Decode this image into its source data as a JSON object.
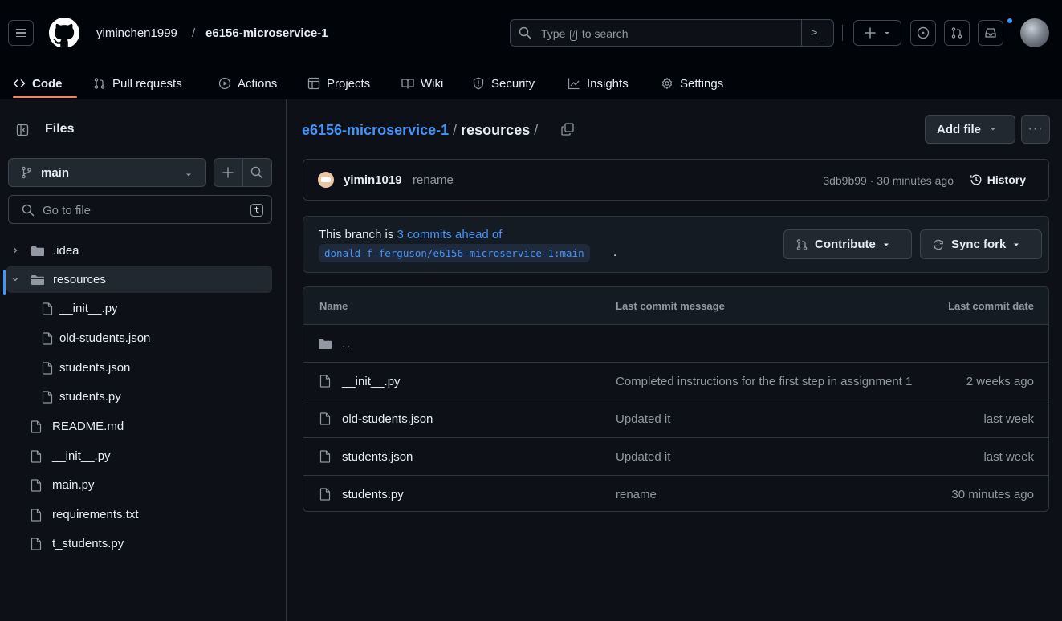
{
  "header": {
    "owner": "yiminchen1999",
    "separator": "/",
    "repo": "e6156-microservice-1",
    "search": {
      "prefix": "Type",
      "key": "/",
      "suffix": "to search",
      "command_palette": ">_"
    }
  },
  "nav": {
    "tabs": [
      {
        "label": "Code",
        "icon": "code-icon",
        "active": true
      },
      {
        "label": "Pull requests",
        "icon": "git-pull-request-icon"
      },
      {
        "label": "Actions",
        "icon": "play-icon"
      },
      {
        "label": "Projects",
        "icon": "table-icon"
      },
      {
        "label": "Wiki",
        "icon": "book-icon"
      },
      {
        "label": "Security",
        "icon": "shield-icon"
      },
      {
        "label": "Insights",
        "icon": "graph-icon"
      },
      {
        "label": "Settings",
        "icon": "gear-icon"
      }
    ]
  },
  "sidebar": {
    "title": "Files",
    "branch": "main",
    "goto_placeholder": "Go to file",
    "goto_shortcut": "t",
    "tree": [
      {
        "label": ".idea",
        "type": "folder",
        "depth": 0,
        "expanded": false
      },
      {
        "label": "resources",
        "type": "folder",
        "depth": 0,
        "expanded": true,
        "selected": true
      },
      {
        "label": "__init__.py",
        "type": "file",
        "depth": 1
      },
      {
        "label": "old-students.json",
        "type": "file",
        "depth": 1
      },
      {
        "label": "students.json",
        "type": "file",
        "depth": 1
      },
      {
        "label": "students.py",
        "type": "file",
        "depth": 1
      },
      {
        "label": "README.md",
        "type": "file",
        "depth": 0
      },
      {
        "label": "__init__.py",
        "type": "file",
        "depth": 0
      },
      {
        "label": "main.py",
        "type": "file",
        "depth": 0
      },
      {
        "label": "requirements.txt",
        "type": "file",
        "depth": 0
      },
      {
        "label": "t_students.py",
        "type": "file",
        "depth": 0
      }
    ]
  },
  "main": {
    "breadcrumb": {
      "repo": "e6156-microservice-1",
      "sep1": " / ",
      "current": "resources",
      "sep2": " /"
    },
    "add_file_label": "Add file",
    "more_label": "···",
    "latest_commit": {
      "author": "yimin1019",
      "message": "rename",
      "meta": "3db9b99 · 30 minutes ago",
      "history_label": "History"
    },
    "branch_status": {
      "prefix": "This branch is ",
      "link": "3 commits ahead of",
      "upstream": "donald-f-ferguson/e6156-microservice-1:main",
      "suffix": ".",
      "contribute_label": "Contribute",
      "sync_label": "Sync fork"
    },
    "table": {
      "headers": {
        "name": "Name",
        "message": "Last commit message",
        "date": "Last commit date"
      },
      "parent_label": "..",
      "rows": [
        {
          "name": "__init__.py",
          "message": "Completed instructions for the first step in assignment 1",
          "date": "2 weeks ago"
        },
        {
          "name": "old-students.json",
          "message": "Updated it",
          "date": "last week"
        },
        {
          "name": "students.json",
          "message": "Updated it",
          "date": "last week"
        },
        {
          "name": "students.py",
          "message": "rename",
          "date": "30 minutes ago"
        }
      ]
    }
  },
  "colors": {
    "background": "#0d1117",
    "header_bg": "#010409",
    "link": "#4493f8",
    "active_tab_underline": "#f78166",
    "muted": "#9198a1",
    "border": "#30363d"
  }
}
